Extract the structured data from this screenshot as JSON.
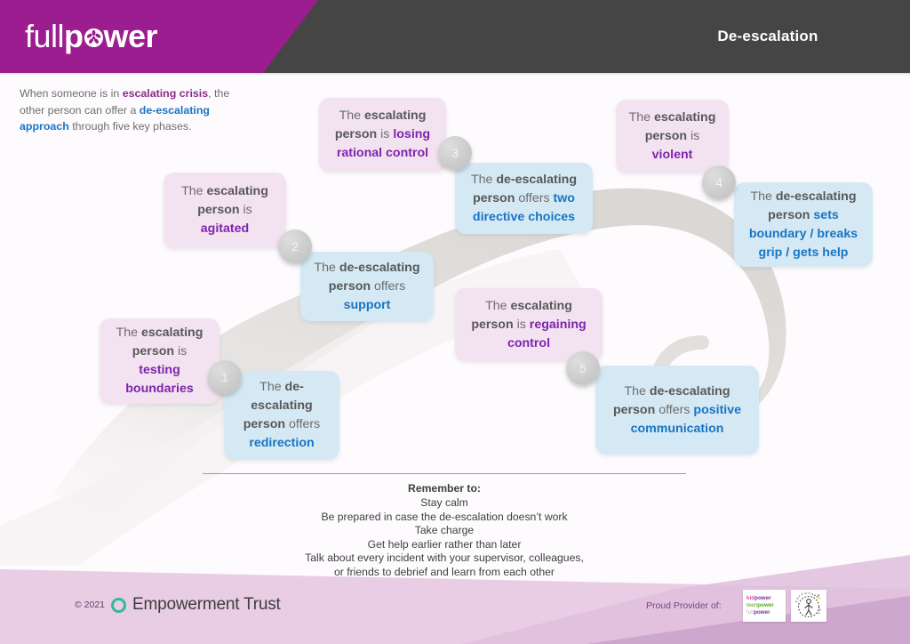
{
  "header": {
    "logo_full": "full",
    "logo_pw_left": "p",
    "logo_pw_right": "wer",
    "logo_icon": "pinwheel-icon",
    "title": "De-escalation"
  },
  "intro": {
    "part1": "When someone is in ",
    "em1": "escalating crisis",
    "part2": ", the other person can offer a ",
    "em2": "de-escalating approach",
    "part3": " through five key phases."
  },
  "phases": [
    {
      "number": "1",
      "escalating": {
        "pre": "The ",
        "b1": "escalating",
        "mid": " person",
        "b2": " is",
        "em": "testing boundaries"
      },
      "deescalating": {
        "pre": "The ",
        "b1": "de-escalating",
        "mid": " person",
        "b2": " offers",
        "em": "redirection"
      }
    },
    {
      "number": "2",
      "escalating": {
        "pre": "The ",
        "b1": "escalating",
        "mid": " person",
        "b2": " is",
        "em": "agitated"
      },
      "deescalating": {
        "pre": "The ",
        "b1": "de-escalating",
        "mid": " person",
        "b2": " offers",
        "em": "support"
      }
    },
    {
      "number": "3",
      "escalating": {
        "pre": "The ",
        "b1": "escalating",
        "mid": " person",
        "b2": " is",
        "em": "losing rational control"
      },
      "deescalating": {
        "pre": "The ",
        "b1": "de-escalating",
        "mid": " person",
        "b2": " offers",
        "em": "two directive choices"
      }
    },
    {
      "number": "4",
      "escalating": {
        "pre": "The ",
        "b1": "escalating",
        "mid": " person",
        "b2": " is",
        "em": "violent"
      },
      "deescalating": {
        "pre": "The ",
        "b1": "de-escalating",
        "mid": " person",
        "b2": "",
        "em": "sets boundary / breaks grip / gets help"
      }
    },
    {
      "number": "5",
      "escalating": {
        "pre": "The ",
        "b1": "escalating",
        "mid": " person",
        "b2": " is",
        "em": "regaining control"
      },
      "deescalating": {
        "pre": "The ",
        "b1": "de-escalating",
        "mid": " person",
        "b2": " offers",
        "em": "positive communication"
      }
    }
  ],
  "remember": {
    "title": "Remember to:",
    "lines": [
      "Stay calm",
      "Be prepared in case the de-escalation doesn’t work",
      "Take charge",
      "Get help earlier rather than later",
      "Talk about every incident with your supervisor, colleagues,",
      "or friends to debrief and learn from each other"
    ]
  },
  "footer": {
    "copyright": "© 2021",
    "org_name": "Empowerment Trust",
    "proud_provider": "Proud Provider of:",
    "kidpower_logo": {
      "l1a": "kid",
      "l1b": "power",
      "l2a": "teen",
      "l2b": "power",
      "l3a": "full",
      "l3b": "power"
    },
    "safeguarding_logo": "safeguarding-award-icon"
  },
  "colors": {
    "brand_magenta": "#9c1d8f",
    "header_dark": "#454545",
    "card_pink": "#f3e2f0",
    "card_blue": "#d4e9f4",
    "accent_purple": "#7d24ad",
    "accent_blue": "#1a74c4",
    "band_light": "#e3c7e0",
    "band_dark": "#cba4cb"
  }
}
